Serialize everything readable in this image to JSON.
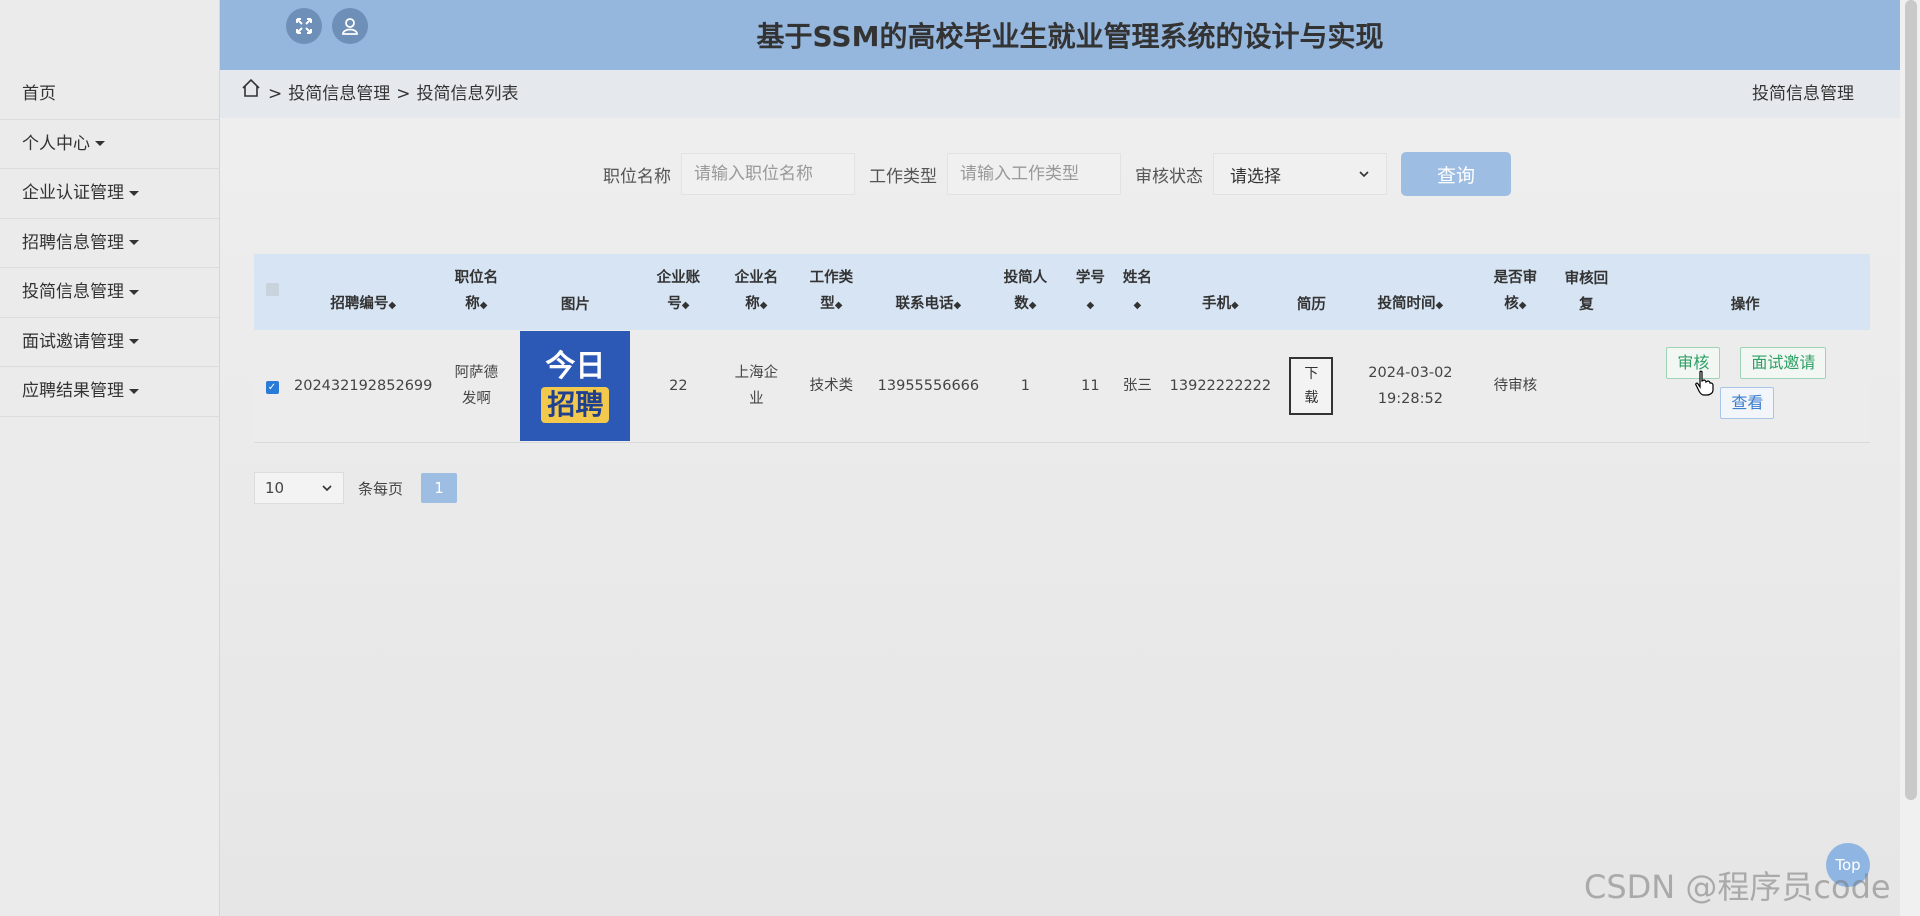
{
  "app": {
    "title": "基于SSM的高校毕业生就业管理系统的设计与实现"
  },
  "sidebar": {
    "items": [
      {
        "label": "首页",
        "dropdown": false
      },
      {
        "label": "个人中心",
        "dropdown": true
      },
      {
        "label": "企业认证管理",
        "dropdown": true
      },
      {
        "label": "招聘信息管理",
        "dropdown": true
      },
      {
        "label": "投简信息管理",
        "dropdown": true
      },
      {
        "label": "面试邀请管理",
        "dropdown": true
      },
      {
        "label": "应聘结果管理",
        "dropdown": true
      }
    ]
  },
  "breadcrumb": {
    "sep": ">",
    "level1": "投简信息管理",
    "level2": "投简信息列表",
    "right": "投简信息管理"
  },
  "search": {
    "job_label": "职位名称",
    "job_placeholder": "请输入职位名称",
    "worktype_label": "工作类型",
    "worktype_placeholder": "请输入工作类型",
    "status_label": "审核状态",
    "status_value": "请选择",
    "query_button": "查询"
  },
  "table": {
    "headers": {
      "recruit_no": "招聘编号",
      "job_name_1": "职位名",
      "job_name_2": "称",
      "image": "图片",
      "company_acct_1": "企业账",
      "company_acct_2": "号",
      "company_name_1": "企业名",
      "company_name_2": "称",
      "work_type_1": "工作类",
      "work_type_2": "型",
      "phone": "联系电话",
      "applicants_1": "投简人",
      "applicants_2": "数",
      "student_no_1": "学号",
      "name_1": "姓名",
      "mobile": "手机",
      "resume": "简历",
      "apply_time": "投简时间",
      "reviewed_1": "是否审",
      "reviewed_2": "核",
      "reply_1": "审核回",
      "reply_2": "复",
      "ops": "操作",
      "sort_icon": "◆"
    },
    "rows": [
      {
        "recruit_no": "202432192852699",
        "job_name_1": "阿萨德",
        "job_name_2": "发啊",
        "image_text_1": "今日",
        "image_text_2": "招聘",
        "company_acct": "22",
        "company_name_1": "上海企",
        "company_name_2": "业",
        "work_type": "技术类",
        "phone": "13955556666",
        "applicants": "1",
        "student_no": "11",
        "name": "张三",
        "mobile": "13922222222",
        "resume_btn_1": "下",
        "resume_btn_2": "载",
        "apply_date": "2024-03-02",
        "apply_clock": "19:28:52",
        "reviewed": "待审核",
        "reply": "",
        "op_review": "审核",
        "op_invite": "面试邀请",
        "op_view": "查看"
      }
    ]
  },
  "pagination": {
    "per_page": "10",
    "per_page_label": "条每页",
    "current_page": "1"
  },
  "top_button": "Top",
  "watermark": "CSDN @程序员code",
  "colors": {
    "header_bg": "#95b6dd",
    "accent": "#9dbde3",
    "success_text": "#2ea066"
  }
}
